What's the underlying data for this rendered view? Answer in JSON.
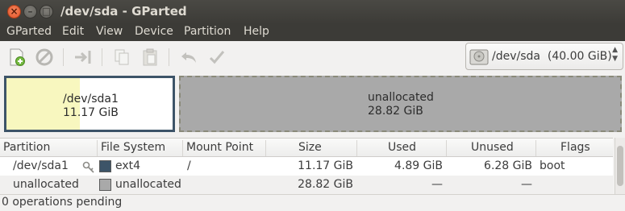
{
  "window": {
    "title": "/dev/sda - GParted"
  },
  "menu": [
    "GParted",
    "Edit",
    "View",
    "Device",
    "Partition",
    "Help"
  ],
  "device_selector": {
    "label": "/dev/sda",
    "size": "(40.00 GiB)"
  },
  "graph": {
    "partition": {
      "name": "/dev/sda1",
      "size": "11.17 GiB",
      "used_fraction": 0.44,
      "color": "#3d5468",
      "used_color": "#f8f7bf"
    },
    "unallocated": {
      "name": "unallocated",
      "size": "28.82 GiB",
      "color": "#a9a9a9"
    }
  },
  "table": {
    "headers": [
      "Partition",
      "File System",
      "Mount Point",
      "Size",
      "Used",
      "Unused",
      "Flags"
    ],
    "rows": [
      {
        "partition": "/dev/sda1",
        "fs": "ext4",
        "fs_color": "#3d5468",
        "mount": "/",
        "size": "11.17 GiB",
        "used": "4.89 GiB",
        "unused": "6.28 GiB",
        "flags": "boot"
      },
      {
        "partition": "unallocated",
        "fs": "unallocated",
        "fs_color": "#a9a9a9",
        "mount": "",
        "size": "28.82 GiB",
        "used": "—",
        "unused": "—",
        "flags": ""
      }
    ]
  },
  "status": {
    "text": "0 operations pending"
  }
}
